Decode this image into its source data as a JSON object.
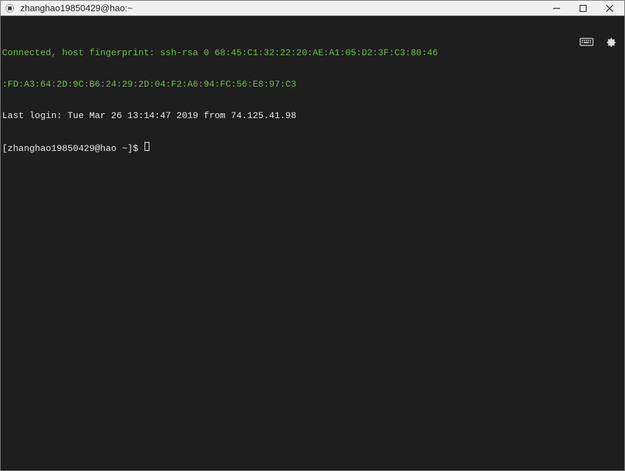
{
  "window": {
    "title": "zhanghao19850429@hao:~"
  },
  "terminal": {
    "line1": "Connected, host fingerprint: ssh-rsa 0 68:45:C1:32:22:20:AE:A1:05:D2:3F:C3:80:46",
    "line2": ":FD:A3:64:2D:9C:B6:24:29:2D:04:F2:A6:94:FC:56:E8:97:C3",
    "line3": "Last login: Tue Mar 26 13:14:47 2019 from 74.125.41.98",
    "prompt": "[zhanghao19850429@hao ~]$ "
  },
  "icons": {
    "keyboard": "keyboard-icon",
    "settings": "gear-icon",
    "app": "terminal-app-icon"
  }
}
